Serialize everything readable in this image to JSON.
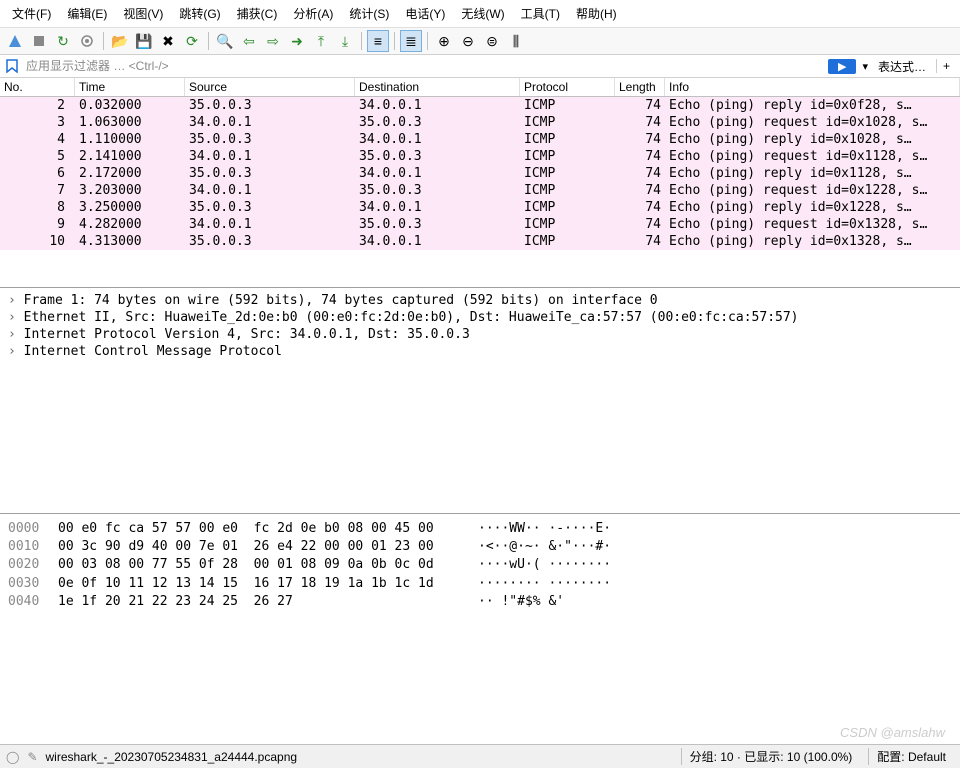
{
  "menu": {
    "items": [
      "文件(F)",
      "编辑(E)",
      "视图(V)",
      "跳转(G)",
      "捕获(C)",
      "分析(A)",
      "统计(S)",
      "电话(Y)",
      "无线(W)",
      "工具(T)",
      "帮助(H)"
    ]
  },
  "toolbar": {
    "icons": [
      "fin",
      "stop",
      "restart",
      "options",
      "open",
      "save",
      "close",
      "reload",
      "sep",
      "find",
      "back",
      "fwd",
      "jump",
      "first",
      "last",
      "sep",
      "autoscroll",
      "sep",
      "colorize",
      "sep",
      "zoomin",
      "zoomout",
      "zoomreset",
      "resize"
    ]
  },
  "filter": {
    "placeholder": "应用显示过滤器 … <Ctrl-/>",
    "arrow": "▶",
    "expression": "表达式…",
    "plus": "+"
  },
  "columns": {
    "no": "No.",
    "time": "Time",
    "source": "Source",
    "destination": "Destination",
    "protocol": "Protocol",
    "length": "Length",
    "info": "Info"
  },
  "packets": [
    {
      "no": "2",
      "time": "0.032000",
      "src": "35.0.0.3",
      "dst": "34.0.0.1",
      "proto": "ICMP",
      "len": "74",
      "info": "Echo (ping) reply    id=0x0f28, s…"
    },
    {
      "no": "3",
      "time": "1.063000",
      "src": "34.0.0.1",
      "dst": "35.0.0.3",
      "proto": "ICMP",
      "len": "74",
      "info": "Echo (ping) request  id=0x1028, s…"
    },
    {
      "no": "4",
      "time": "1.110000",
      "src": "35.0.0.3",
      "dst": "34.0.0.1",
      "proto": "ICMP",
      "len": "74",
      "info": "Echo (ping) reply    id=0x1028, s…"
    },
    {
      "no": "5",
      "time": "2.141000",
      "src": "34.0.0.1",
      "dst": "35.0.0.3",
      "proto": "ICMP",
      "len": "74",
      "info": "Echo (ping) request  id=0x1128, s…"
    },
    {
      "no": "6",
      "time": "2.172000",
      "src": "35.0.0.3",
      "dst": "34.0.0.1",
      "proto": "ICMP",
      "len": "74",
      "info": "Echo (ping) reply    id=0x1128, s…"
    },
    {
      "no": "7",
      "time": "3.203000",
      "src": "34.0.0.1",
      "dst": "35.0.0.3",
      "proto": "ICMP",
      "len": "74",
      "info": "Echo (ping) request  id=0x1228, s…"
    },
    {
      "no": "8",
      "time": "3.250000",
      "src": "35.0.0.3",
      "dst": "34.0.0.1",
      "proto": "ICMP",
      "len": "74",
      "info": "Echo (ping) reply    id=0x1228, s…"
    },
    {
      "no": "9",
      "time": "4.282000",
      "src": "34.0.0.1",
      "dst": "35.0.0.3",
      "proto": "ICMP",
      "len": "74",
      "info": "Echo (ping) request  id=0x1328, s…"
    },
    {
      "no": "10",
      "time": "4.313000",
      "src": "35.0.0.3",
      "dst": "34.0.0.1",
      "proto": "ICMP",
      "len": "74",
      "info": "Echo (ping) reply    id=0x1328, s…"
    }
  ],
  "details": [
    "Frame 1: 74 bytes on wire (592 bits), 74 bytes captured (592 bits) on interface 0",
    "Ethernet II, Src: HuaweiTe_2d:0e:b0 (00:e0:fc:2d:0e:b0), Dst: HuaweiTe_ca:57:57 (00:e0:fc:ca:57:57)",
    "Internet Protocol Version 4, Src: 34.0.0.1, Dst: 35.0.0.3",
    "Internet Control Message Protocol"
  ],
  "hex": [
    {
      "off": "0000",
      "b": "00 e0 fc ca 57 57 00 e0  fc 2d 0e b0 08 00 45 00",
      "a": "····WW·· ·-····E·"
    },
    {
      "off": "0010",
      "b": "00 3c 90 d9 40 00 7e 01  26 e4 22 00 00 01 23 00",
      "a": "·<··@·~· &·\"···#·"
    },
    {
      "off": "0020",
      "b": "00 03 08 00 77 55 0f 28  00 01 08 09 0a 0b 0c 0d",
      "a": "····wU·( ········"
    },
    {
      "off": "0030",
      "b": "0e 0f 10 11 12 13 14 15  16 17 18 19 1a 1b 1c 1d",
      "a": "········ ········"
    },
    {
      "off": "0040",
      "b": "1e 1f 20 21 22 23 24 25  26 27",
      "a": "·· !\"#$% &'"
    }
  ],
  "status": {
    "file": "wireshark_-_20230705234831_a24444.pcapng",
    "packets": "分组: 10 · 已显示: 10 (100.0%)",
    "profile": "配置: Default"
  },
  "watermark": "CSDN @amslahw"
}
